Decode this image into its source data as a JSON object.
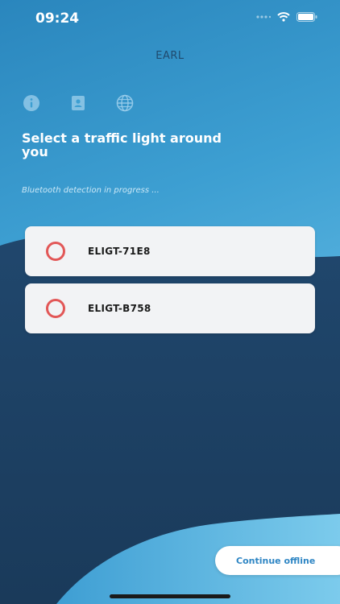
{
  "status_bar": {
    "time": "09:24"
  },
  "header": {
    "title": "EARL"
  },
  "top_icons": [
    "info-icon",
    "contact-card-icon",
    "globe-icon"
  ],
  "main": {
    "headline": "Select a traffic light around you",
    "subtitle": "Bluetooth detection in progress ...",
    "devices": [
      {
        "name": "ELIGT-71E8"
      },
      {
        "name": "ELIGT-B758"
      }
    ]
  },
  "footer": {
    "continue_offline_label": "Continue offline"
  },
  "colors": {
    "accent": "#2f86c4",
    "dark_navy": "#1c3d5e",
    "radio_red": "#e25757",
    "card_bg": "#f2f3f5"
  }
}
